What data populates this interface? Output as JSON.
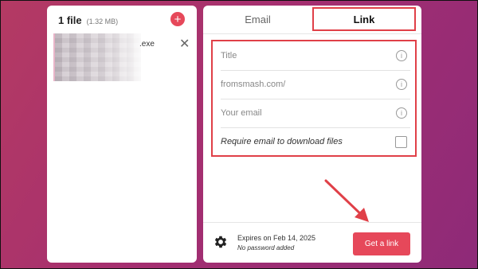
{
  "files": {
    "count_label": "1 file",
    "size_label": "(1.32 MB)",
    "add_icon": "plus-icon",
    "items": [
      {
        "name": ".exe"
      }
    ]
  },
  "tabs": [
    {
      "label": "Email",
      "active": false
    },
    {
      "label": "Link",
      "active": true
    }
  ],
  "form": {
    "title_placeholder": "Title",
    "url_placeholder": "fromsmash.com/",
    "email_placeholder": "Your email",
    "require_email_label": "Require email to download files",
    "info_glyph": "i"
  },
  "footer": {
    "expires": "Expires on Feb 14, 2025",
    "password": "No password added",
    "button": "Get a link"
  },
  "colors": {
    "accent": "#e6485a",
    "highlight": "#e04048"
  }
}
